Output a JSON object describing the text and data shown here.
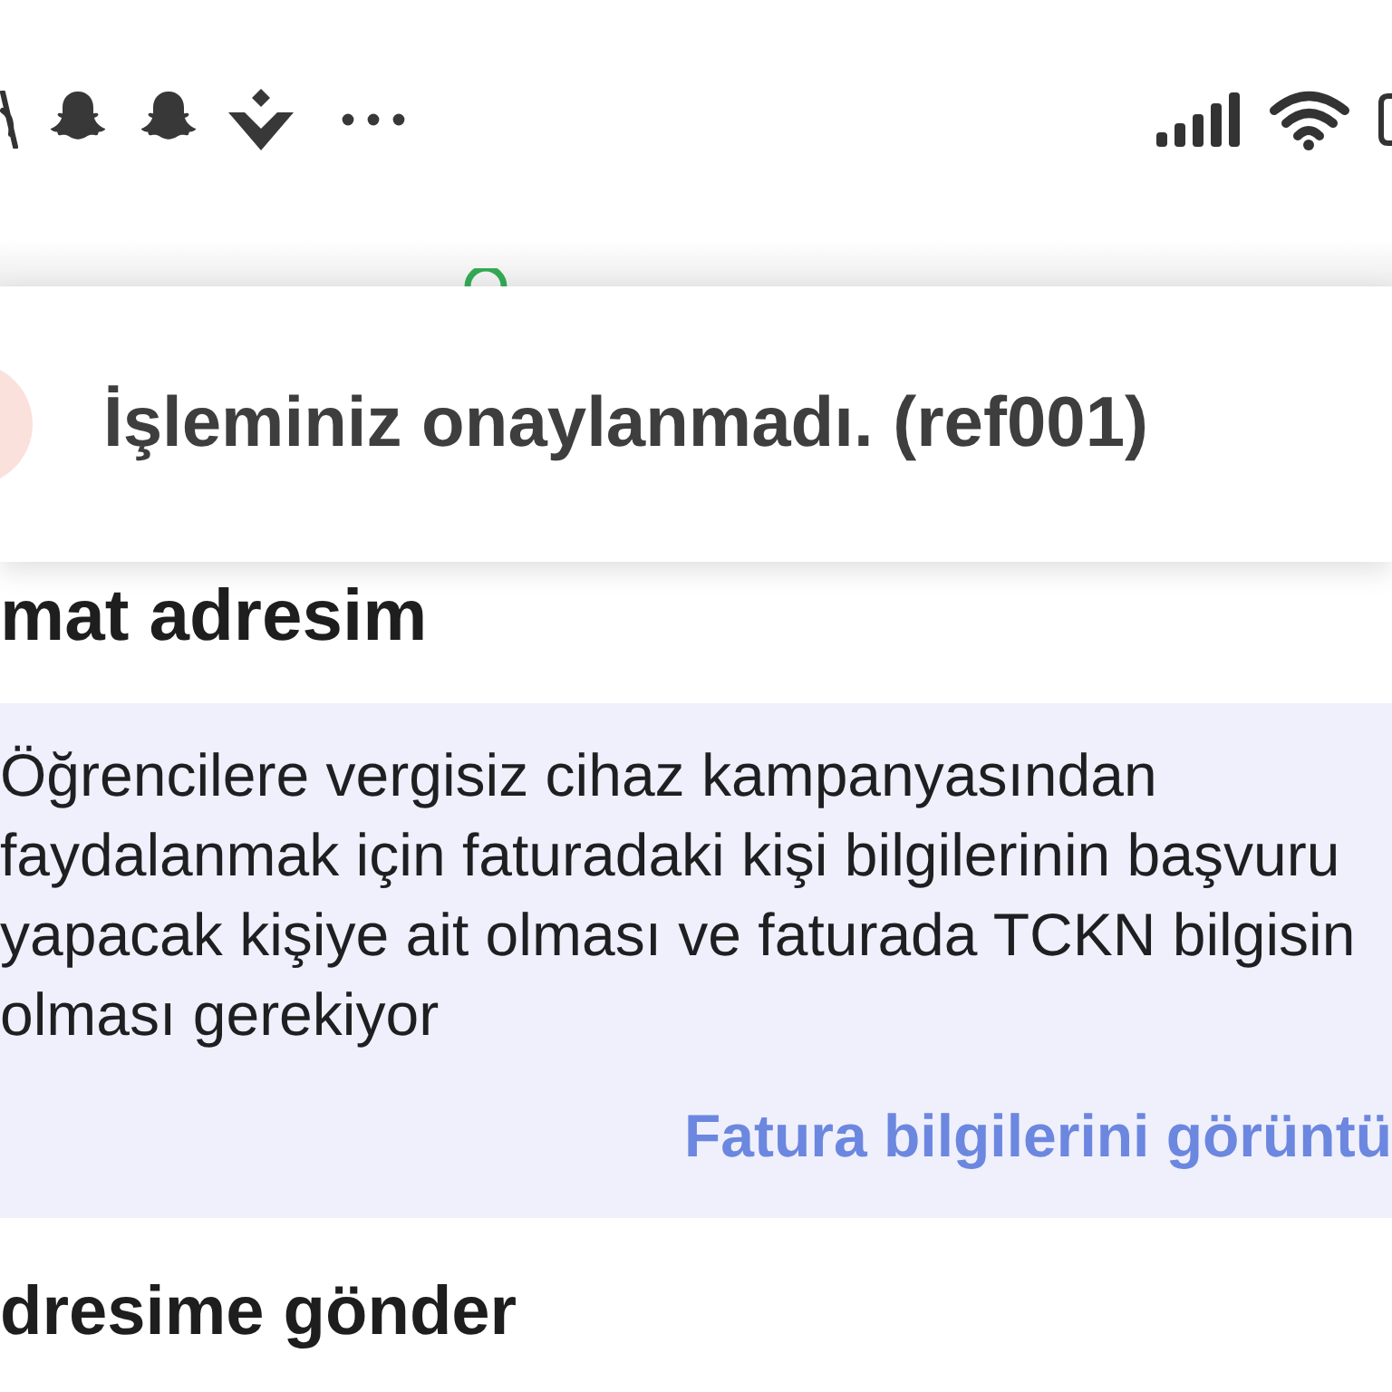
{
  "toast": {
    "message": "İşleminiz onaylanmadı. (ref001)"
  },
  "section_title": "mat adresim",
  "notice": {
    "lines": [
      "Öğrencilere vergisiz cihaz kampanyasından",
      "faydalanmak için faturadaki kişi bilgilerinin başvuru",
      "yapacak kişiye ait olması ve faturada TCKN bilgisin",
      "olması gerekiyor"
    ],
    "link": "Fatura bilgilerini görüntü"
  },
  "next_section_title": "dresime gönder"
}
